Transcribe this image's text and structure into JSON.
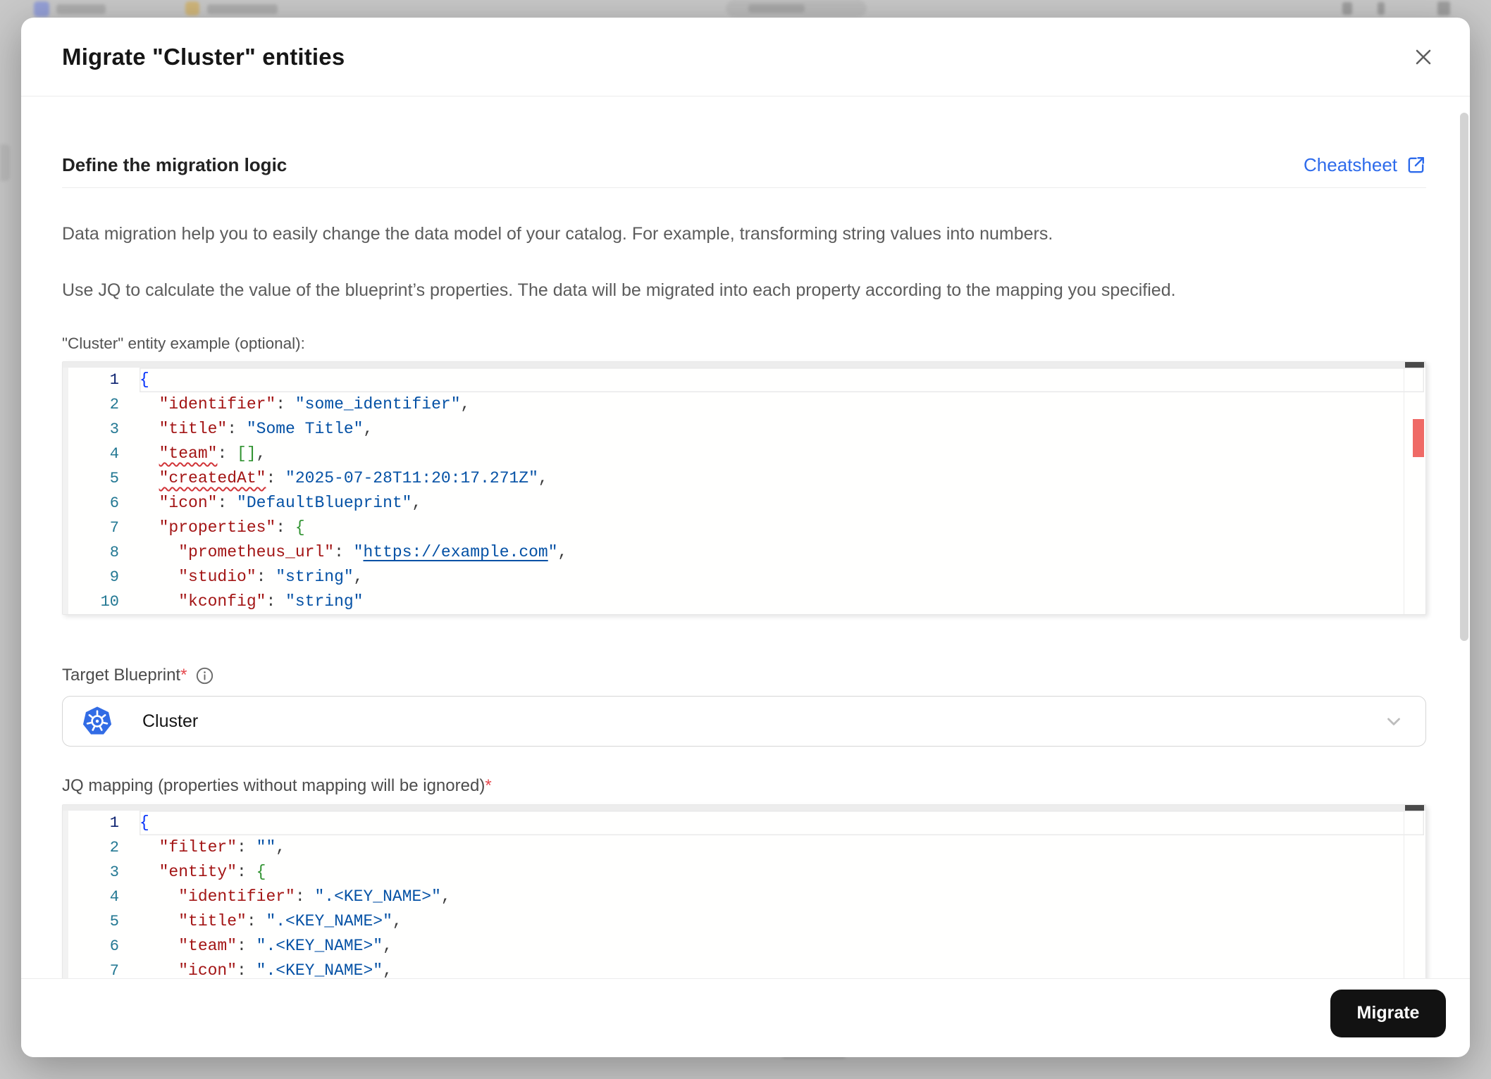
{
  "colors": {
    "accent_blue": "#2e6beb",
    "error_red": "#e5484d",
    "kubernetes_blue": "#326ce5",
    "migrate_button": "#121212",
    "code_key": "#a31515",
    "code_value": "#0451a5",
    "overview_error_marker": "#ef6a66"
  },
  "dialog": {
    "title": "Migrate \"Cluster\" entities",
    "close_icon": "x-close"
  },
  "section": {
    "heading": "Define the migration logic",
    "cheatsheet_label": "Cheatsheet",
    "cheatsheet_icon": "external-link"
  },
  "description": {
    "p1": "Data migration help you to easily change the data model of your catalog. For example, transforming string values into numbers.",
    "p2": "Use JQ to calculate the value of the blueprint’s properties. The data will be migrated into each property according to the mapping you specified."
  },
  "example_editor": {
    "label": "\"Cluster\" entity example (optional):",
    "has_error_marker": true,
    "lines": [
      {
        "n": 1,
        "current": true,
        "tokens": [
          [
            "br0",
            "{"
          ]
        ]
      },
      {
        "n": 2,
        "tokens": [
          [
            "pl",
            "  "
          ],
          [
            "key",
            "\"identifier\""
          ],
          [
            "pun",
            ": "
          ],
          [
            "val",
            "\"some_identifier\""
          ],
          [
            "pun",
            ","
          ]
        ]
      },
      {
        "n": 3,
        "tokens": [
          [
            "pl",
            "  "
          ],
          [
            "key",
            "\"title\""
          ],
          [
            "pun",
            ": "
          ],
          [
            "val",
            "\"Some Title\""
          ],
          [
            "pun",
            ","
          ]
        ]
      },
      {
        "n": 4,
        "tokens": [
          [
            "pl",
            "  "
          ],
          [
            "key err",
            "\"team\""
          ],
          [
            "pun",
            ": "
          ],
          [
            "br1",
            "[]"
          ],
          [
            "pun",
            ","
          ]
        ]
      },
      {
        "n": 5,
        "tokens": [
          [
            "pl",
            "  "
          ],
          [
            "key err",
            "\"createdAt\""
          ],
          [
            "pun",
            ": "
          ],
          [
            "val",
            "\"2025-07-28T11:20:17.271Z\""
          ],
          [
            "pun",
            ","
          ]
        ]
      },
      {
        "n": 6,
        "tokens": [
          [
            "pl",
            "  "
          ],
          [
            "key",
            "\"icon\""
          ],
          [
            "pun",
            ": "
          ],
          [
            "val",
            "\"DefaultBlueprint\""
          ],
          [
            "pun",
            ","
          ]
        ]
      },
      {
        "n": 7,
        "tokens": [
          [
            "pl",
            "  "
          ],
          [
            "key",
            "\"properties\""
          ],
          [
            "pun",
            ": "
          ],
          [
            "br1",
            "{"
          ]
        ]
      },
      {
        "n": 8,
        "tokens": [
          [
            "pl",
            "    "
          ],
          [
            "key",
            "\"prometheus_url\""
          ],
          [
            "pun",
            ": "
          ],
          [
            "val",
            "\""
          ],
          [
            "val lnk",
            "https://example.com"
          ],
          [
            "val",
            "\""
          ],
          [
            "pun",
            ","
          ]
        ]
      },
      {
        "n": 9,
        "tokens": [
          [
            "pl",
            "    "
          ],
          [
            "key",
            "\"studio\""
          ],
          [
            "pun",
            ": "
          ],
          [
            "val",
            "\"string\""
          ],
          [
            "pun",
            ","
          ]
        ]
      },
      {
        "n": 10,
        "tokens": [
          [
            "pl",
            "    "
          ],
          [
            "key",
            "\"kconfig\""
          ],
          [
            "pun",
            ": "
          ],
          [
            "val",
            "\"string\""
          ]
        ]
      }
    ]
  },
  "target_blueprint": {
    "label": "Target Blueprint",
    "required_mark": "*",
    "info_icon": "info-circle",
    "value": "Cluster",
    "value_icon": "kubernetes",
    "chevron_icon": "chevron-down"
  },
  "jq_editor": {
    "label": "JQ mapping (properties without mapping will be ignored)",
    "required_mark": "*",
    "lines": [
      {
        "n": 1,
        "current": true,
        "tokens": [
          [
            "br0",
            "{"
          ]
        ]
      },
      {
        "n": 2,
        "tokens": [
          [
            "pl",
            "  "
          ],
          [
            "key",
            "\"filter\""
          ],
          [
            "pun",
            ": "
          ],
          [
            "val",
            "\"\""
          ],
          [
            "pun",
            ","
          ]
        ]
      },
      {
        "n": 3,
        "tokens": [
          [
            "pl",
            "  "
          ],
          [
            "key",
            "\"entity\""
          ],
          [
            "pun",
            ": "
          ],
          [
            "br1",
            "{"
          ]
        ]
      },
      {
        "n": 4,
        "tokens": [
          [
            "pl",
            "    "
          ],
          [
            "key",
            "\"identifier\""
          ],
          [
            "pun",
            ": "
          ],
          [
            "val",
            "\".<KEY_NAME>\""
          ],
          [
            "pun",
            ","
          ]
        ]
      },
      {
        "n": 5,
        "tokens": [
          [
            "pl",
            "    "
          ],
          [
            "key",
            "\"title\""
          ],
          [
            "pun",
            ": "
          ],
          [
            "val",
            "\".<KEY_NAME>\""
          ],
          [
            "pun",
            ","
          ]
        ]
      },
      {
        "n": 6,
        "tokens": [
          [
            "pl",
            "    "
          ],
          [
            "key",
            "\"team\""
          ],
          [
            "pun",
            ": "
          ],
          [
            "val",
            "\".<KEY_NAME>\""
          ],
          [
            "pun",
            ","
          ]
        ]
      },
      {
        "n": 7,
        "tokens": [
          [
            "pl",
            "    "
          ],
          [
            "key",
            "\"icon\""
          ],
          [
            "pun",
            ": "
          ],
          [
            "val",
            "\".<KEY_NAME>\""
          ],
          [
            "pun",
            ","
          ]
        ]
      }
    ]
  },
  "footer": {
    "migrate_label": "Migrate"
  }
}
